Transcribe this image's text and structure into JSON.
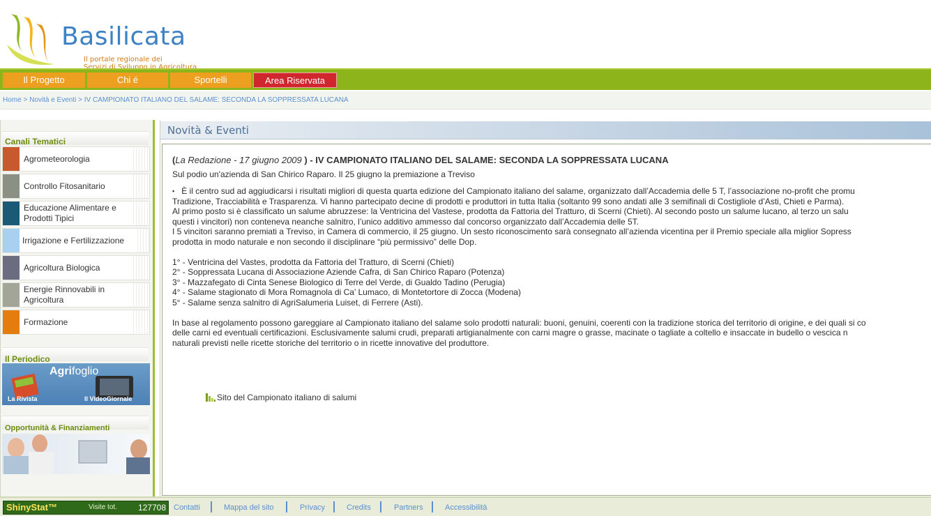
{
  "header": {
    "logo_title": "Basilicata",
    "logo_subtitle_line1": "Il portale regionale dei",
    "logo_subtitle_line2": "Servizi di Sviluppo in Agricoltura"
  },
  "nav": {
    "items": [
      {
        "label": "Il Progetto"
      },
      {
        "label": "Chi é"
      },
      {
        "label": "Sportelli"
      },
      {
        "label": "Area Riservata"
      }
    ]
  },
  "breadcrumb": {
    "home": "Home",
    "section": "Novità e Eventi",
    "current": "IV CAMPIONATO ITALIANO DEL SALAME: SECONDA LA SOPPRESSATA LUCANA",
    "separator": ">"
  },
  "sidebar": {
    "canali_title": "Canali Tematici",
    "canali": [
      {
        "label": "Agrometeorologia",
        "color": "#c8582e"
      },
      {
        "label": "Controllo Fitosanitario",
        "color": "#8a9084"
      },
      {
        "label": "Educazione Alimentare e Prodotti Tipici",
        "color": "#1b5a77"
      },
      {
        "label": "Irrigazione e Fertilizzazione",
        "color": "#aad0ef"
      },
      {
        "label": "Agricoltura Biologica",
        "color": "#6c6c80"
      },
      {
        "label": "Energie Rinnovabili in Agricoltura",
        "color": "#a3a598"
      },
      {
        "label": "Formazione",
        "color": "#e57c0e"
      }
    ],
    "periodico_title": "Il Periodico",
    "agrifoglio_brand": "Agri",
    "agrifoglio_brand2": "foglio",
    "rivista": "La Rivista",
    "videogiornale": "Il VideoGiornale",
    "opportunita_title": "Opportunità & Finanziamenti"
  },
  "main": {
    "section_title": "Novità & Eventi",
    "article": {
      "title_open": "(",
      "title_author": "La Redazione - 17 giugno 2009",
      "title_rest": ") - IV CAMPIONATO ITALIANO DEL SALAME: SECONDA LA SOPPRESSATA LUCANA",
      "subtitle": "Sul podio un'azienda di San Chirico Raparo. Il 25 giugno la premiazione a Treviso",
      "bullet": "▪",
      "p1_l1": "È il centro sud ad aggiudicarsi i risultati migliori di questa quarta edizione del Campionato italiano del salame, organizzato dall’Accademia delle 5 T, l’associazione no-profit che promu",
      "p1_l2": "Tradizione, Tracciabilità e Trasparenza. Vi hanno partecipato decine di prodotti e produttori in tutta Italia (soltanto 99 sono andati alle 3 semifinali di Costigliole d’Asti, Chieti e Parma).",
      "p1_l3": "Al primo posto si è classificato un salume abruzzese: la Ventricina del Vastese, prodotta da Fattoria del Tratturo, di Scerni (Chieti). Al secondo posto un salume lucano, al terzo un salu",
      "p1_l4": "questi i vincitori) non conteneva neanche salnitro, l’unico additivo ammesso dal concorso organizzato dall’Accademia delle 5T.",
      "p1_l5": "I 5 vincitori saranno premiati a Treviso, in Camera di commercio, il 25 giugno. Un sesto riconoscimento sarà consegnato all’azienda vicentina per il Premio speciale alla miglior Sopress",
      "p1_l6": "prodotta in modo naturale e non secondo il disciplinare “più permissivo” delle Dop.",
      "rank1": "1° - Ventricina del Vastes, prodotta da Fattoria del Tratturo, di Scerni (Chieti)",
      "rank2": "2° - Soppressata Lucana di Associazione Aziende Cafra, di San Chirico Raparo (Potenza)",
      "rank3": "3° - Mazzafegato di Cinta Senese Biologico di Terre del Verde, di Gualdo Tadino (Perugia)",
      "rank4": "4° - Salame stagionato di Mora Romagnola di Ca’ Lumaco, di Montetortore di Zocca (Modena)",
      "rank5": "5° - Salame senza salnitro di AgriSalumeria Luiset, di Ferrere (Asti).",
      "p2_l1": "In base al regolamento possono gareggiare al Campionato italiano del salame solo prodotti naturali: buoni, genuini, coerenti con la tradizione storica del territorio di origine, e dei quali si co",
      "p2_l2": "delle carni ed eventuali certificazioni. Esclusivamente salumi crudi, preparati artigianalmente con carni magre o grasse, macinate o tagliate a coltello e insaccate in budello o vescica n",
      "p2_l3": "naturali previsti nelle ricette storiche del territorio o in ricette innovative del produttore.",
      "link_label": "Sito del Campionato italiano di salumi"
    }
  },
  "footer": {
    "counter_brand": "ShinyStat™",
    "counter_label": "Visite tot.",
    "counter_value": "127708",
    "links": [
      "Contatti",
      "Mappa del sito",
      "Privacy",
      "Credits",
      "Partners",
      "Accessibilità"
    ]
  }
}
